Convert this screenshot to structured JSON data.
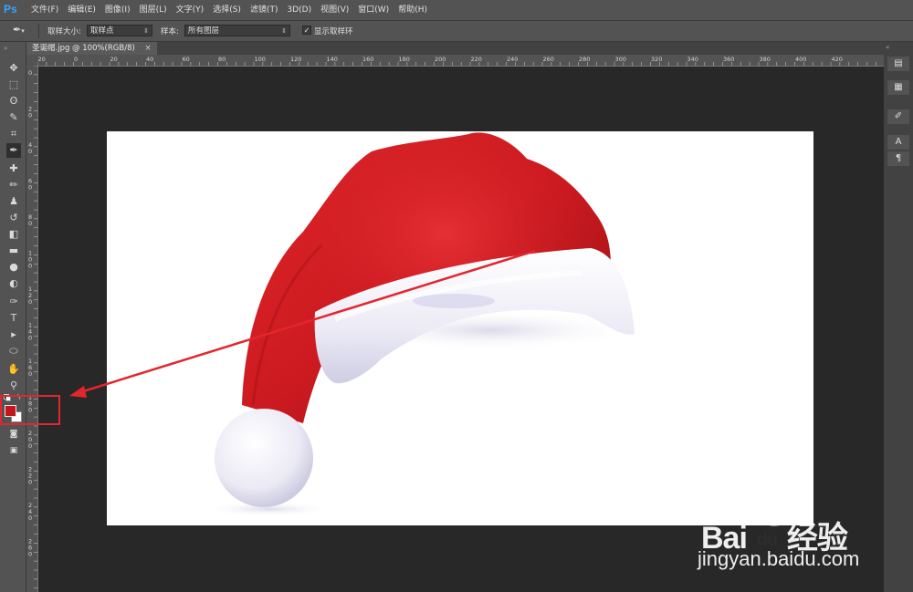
{
  "app": {
    "logo": "Ps"
  },
  "menu": [
    "文件(F)",
    "编辑(E)",
    "图像(I)",
    "图层(L)",
    "文字(Y)",
    "选择(S)",
    "滤镜(T)",
    "3D(D)",
    "视图(V)",
    "窗口(W)",
    "帮助(H)"
  ],
  "options": {
    "sample_size_label": "取样大小:",
    "sample_size_value": "取样点",
    "sample_label": "样本:",
    "sample_value": "所有图层",
    "show_ring_label": "显示取样环",
    "show_ring_checked": true
  },
  "document": {
    "tab_label": "圣诞帽.jpg @ 100%(RGB/8)",
    "close_glyph": "×"
  },
  "ruler": {
    "h_labels": [
      "20",
      "0",
      "20",
      "40",
      "60",
      "80",
      "100",
      "120",
      "140",
      "160",
      "180",
      "200",
      "220",
      "240",
      "260",
      "280",
      "300",
      "320",
      "340",
      "360",
      "380",
      "400",
      "420"
    ],
    "v_labels": [
      "0",
      "2 0",
      "4 0",
      "6 0",
      "8 0",
      "1 0 0",
      "1 2 0",
      "1 4 0",
      "1 6 0",
      "1 8 0",
      "2 0 0",
      "2 2 0",
      "2 4 0",
      "2 6 0"
    ]
  },
  "colors": {
    "foreground": "#c4141c",
    "background": "#ffffff",
    "annotation": "#e3262e"
  },
  "watermark": {
    "brand_left": "Bai",
    "brand_right": "经验",
    "brand_du": "du",
    "url": "jingyan.baidu.com"
  },
  "tools": [
    {
      "name": "move-tool",
      "glyph": "✥"
    },
    {
      "name": "marquee-tool",
      "glyph": "⬚"
    },
    {
      "name": "lasso-tool",
      "glyph": "ʘ"
    },
    {
      "name": "quick-select-tool",
      "glyph": "✎"
    },
    {
      "name": "crop-tool",
      "glyph": "⌗"
    },
    {
      "name": "eyedropper-tool",
      "glyph": "✒"
    },
    {
      "name": "healing-brush-tool",
      "glyph": "✚"
    },
    {
      "name": "brush-tool",
      "glyph": "✏"
    },
    {
      "name": "clone-stamp-tool",
      "glyph": "♟"
    },
    {
      "name": "history-brush-tool",
      "glyph": "↺"
    },
    {
      "name": "eraser-tool",
      "glyph": "◧"
    },
    {
      "name": "gradient-tool",
      "glyph": "▬"
    },
    {
      "name": "blur-tool",
      "glyph": "●"
    },
    {
      "name": "dodge-tool",
      "glyph": "◐"
    },
    {
      "name": "pen-tool",
      "glyph": "✑"
    },
    {
      "name": "type-tool",
      "glyph": "T"
    },
    {
      "name": "path-select-tool",
      "glyph": "▸"
    },
    {
      "name": "shape-tool",
      "glyph": "⬭"
    },
    {
      "name": "hand-tool",
      "glyph": "✋"
    },
    {
      "name": "zoom-tool",
      "glyph": "⚲"
    }
  ],
  "dock": [
    {
      "name": "history-panel-icon",
      "glyph": "▤"
    },
    {
      "name": "properties-panel-icon",
      "glyph": "▦"
    },
    {
      "name": "brush-panel-icon",
      "glyph": "✐"
    },
    {
      "name": "character-panel-icon",
      "glyph": "A"
    },
    {
      "name": "paragraph-panel-icon",
      "glyph": "¶"
    }
  ]
}
